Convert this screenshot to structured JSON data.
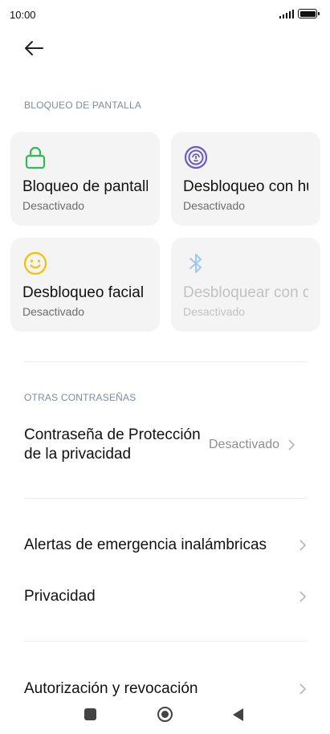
{
  "status_bar": {
    "time": "10:00"
  },
  "header": {
    "back_icon": "arrow-left-icon"
  },
  "screen_lock_section": {
    "label": "BLOQUEO DE PANTALLA",
    "cards": [
      {
        "title": "Bloqueo de pantalla",
        "status": "Desactivado",
        "icon": "padlock-icon",
        "color": "#2dbd52",
        "enabled": true
      },
      {
        "title": "Desbloqueo con huella digital",
        "status": "Desactivado",
        "icon": "fingerprint-icon",
        "color": "#6a5acd",
        "enabled": true
      },
      {
        "title": "Desbloqueo facial",
        "status": "Desactivado",
        "icon": "smiley-face-icon",
        "color": "#f2c200",
        "enabled": true
      },
      {
        "title": "Desbloquear con dispositivo Bluetooth",
        "status": "Desactivado",
        "icon": "bluetooth-icon",
        "color": "#9fc7f0",
        "enabled": false
      }
    ]
  },
  "other_passwords_section": {
    "label": "OTRAS CONTRASEÑAS",
    "privacy_password": {
      "title": "Contraseña de Protección de la privacidad",
      "value": "Desactivado"
    }
  },
  "menu": {
    "emergency_alerts": "Alertas de emergencia inalámbricas",
    "privacy": "Privacidad",
    "authorization": "Autorización y revocación"
  }
}
